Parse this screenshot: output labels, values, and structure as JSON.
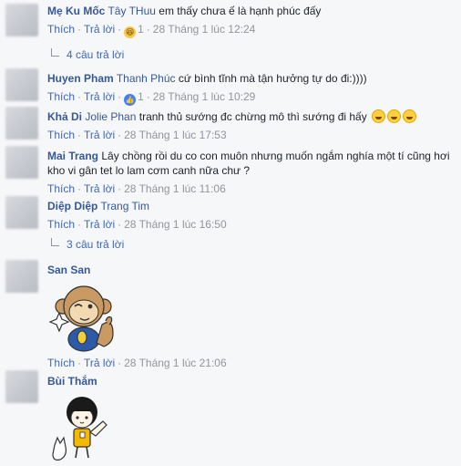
{
  "labels": {
    "like": "Thích",
    "reply": "Trả lời",
    "dot": "·"
  },
  "comments": [
    {
      "name": "Mẹ Ku Mốc",
      "tag": "Tây THuu",
      "text": "em thấy chưa ế là hạnh phúc đấy",
      "reaction_icon": "haha-icon",
      "reaction_count": "1",
      "time": "28 Tháng 1 lúc 12:24"
    },
    {
      "name": "Huyen Pham",
      "tag": "Thanh Phúc",
      "text": "cứ bình tĩnh mà tận hưởng tự do đi:))))",
      "reaction_icon": "like-icon",
      "reaction_count": "1",
      "time": "28 Tháng 1 lúc 10:29"
    },
    {
      "name": "Khả Di",
      "tag": "Jolie Phan",
      "text": "tranh thủ sướng đc chừng mô thì sướng đi hấy",
      "time": "28 Tháng 1 lúc 17:53"
    },
    {
      "name": "Mai Trang",
      "text": "Lây chồng rồi du co con muôn nhưng muốn ngắm nghía một tí cũng hơi kho vi gân tet lo lam cơm canh nữa chư ?",
      "time": "28 Tháng 1 lúc 11:06"
    },
    {
      "name": "Diệp Diệp",
      "tag": "Trang Tim",
      "text": "",
      "time": "28 Tháng 1 lúc 16:50"
    },
    {
      "name": "San San",
      "text": "",
      "time": "28 Tháng 1 lúc 21:06"
    },
    {
      "name": "Bùi Thắm",
      "text": ""
    }
  ],
  "replies": [
    {
      "label": "4 câu trả lời"
    },
    {
      "label": "3 câu trả lời"
    }
  ],
  "colors": {
    "link": "#365899",
    "action": "#4267b2",
    "meta": "#90949c",
    "background": "#f6f7f9"
  }
}
